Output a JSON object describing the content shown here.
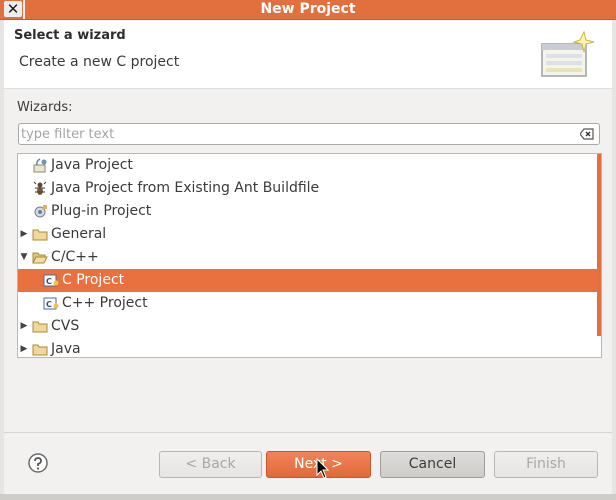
{
  "window": {
    "title": "New Project",
    "close_glyph": "✕"
  },
  "header": {
    "heading": "Select a wizard",
    "description": "Create a new C project"
  },
  "wizards": {
    "label": "Wizards:",
    "filter_placeholder": "type filter text",
    "filter_value": ""
  },
  "tree": {
    "items": [
      {
        "label": "Java Project",
        "icon": "java-project-icon",
        "level": 1,
        "expander": "none"
      },
      {
        "label": "Java Project from Existing Ant Buildfile",
        "icon": "ant-icon",
        "level": 1,
        "expander": "none"
      },
      {
        "label": "Plug-in Project",
        "icon": "plugin-icon",
        "level": 1,
        "expander": "none"
      },
      {
        "label": "General",
        "icon": "folder-icon",
        "level": 0,
        "expander": "collapsed"
      },
      {
        "label": "C/C++",
        "icon": "folder-open-icon",
        "level": 0,
        "expander": "expanded"
      },
      {
        "label": "C Project",
        "icon": "c-project-icon",
        "level": 1,
        "expander": "none",
        "selected": true
      },
      {
        "label": "C++ Project",
        "icon": "cpp-project-icon",
        "level": 1,
        "expander": "none"
      },
      {
        "label": "CVS",
        "icon": "folder-icon",
        "level": 0,
        "expander": "collapsed"
      },
      {
        "label": "Java",
        "icon": "folder-icon",
        "level": 0,
        "expander": "collapsed"
      }
    ]
  },
  "footer": {
    "back_label": "< Back",
    "next_label": "Next >",
    "cancel_label": "Cancel",
    "finish_label": "Finish"
  },
  "colors": {
    "accent": "#e8713f",
    "title_bar": "#e2703f",
    "dialog_bg": "#f2f1f0"
  }
}
